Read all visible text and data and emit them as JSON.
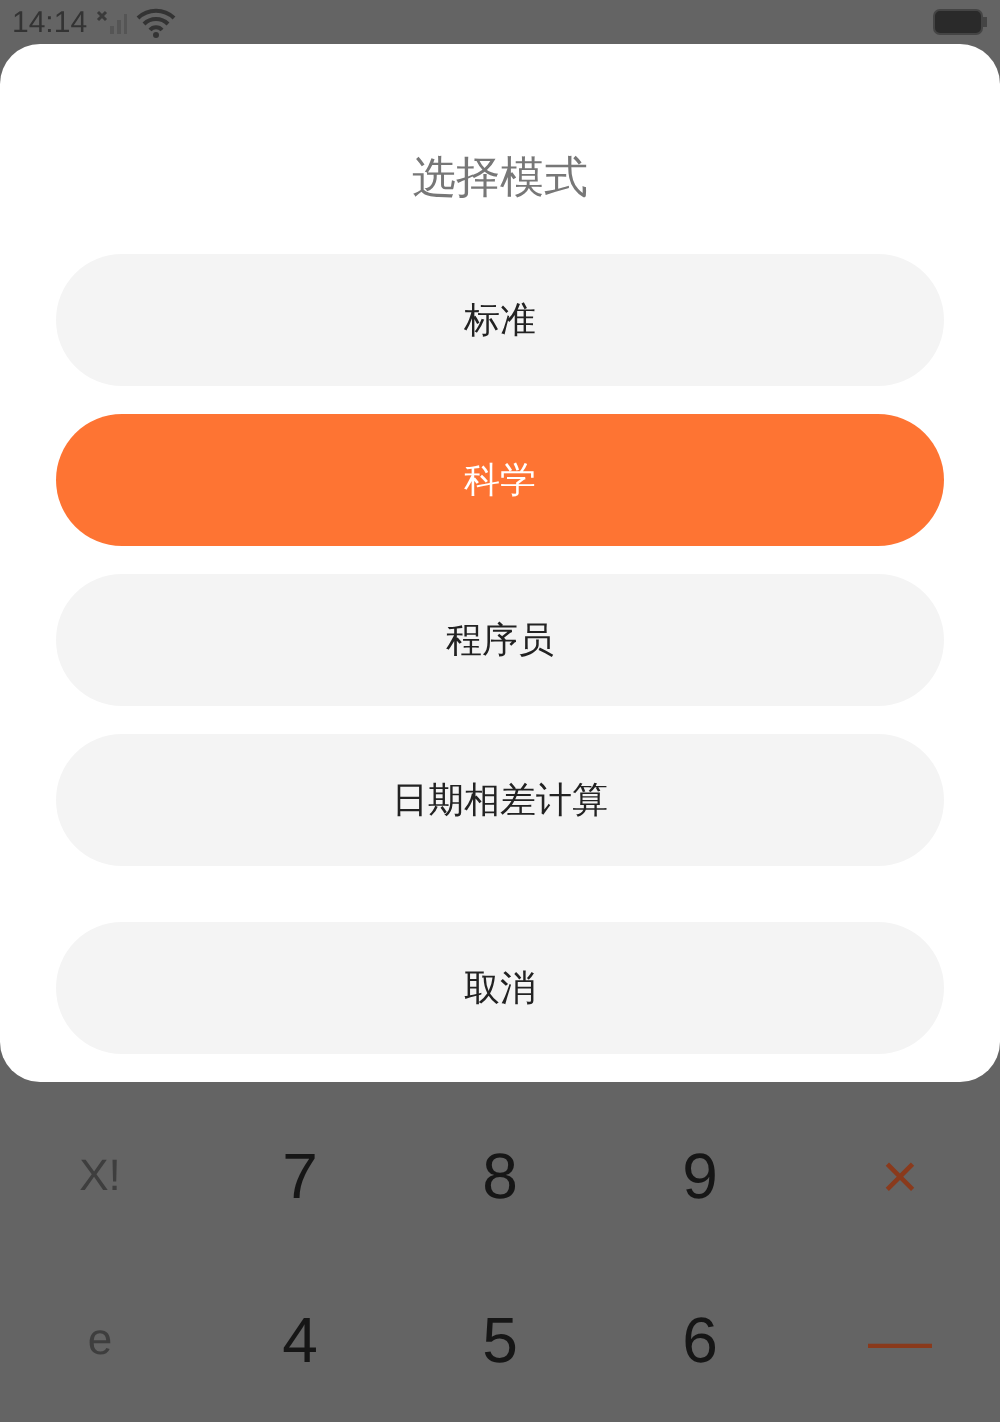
{
  "status_bar": {
    "time": "14:14"
  },
  "dialog": {
    "title": "选择模式",
    "options": [
      {
        "label": "标准",
        "selected": false
      },
      {
        "label": "科学",
        "selected": true
      },
      {
        "label": "程序员",
        "selected": false
      },
      {
        "label": "日期相差计算",
        "selected": false
      }
    ],
    "cancel": "取消"
  },
  "keypad": [
    [
      {
        "label": "X!",
        "kind": "function"
      },
      {
        "label": "7",
        "kind": "digit"
      },
      {
        "label": "8",
        "kind": "digit"
      },
      {
        "label": "9",
        "kind": "digit"
      },
      {
        "label": "×",
        "kind": "operator"
      }
    ],
    [
      {
        "label": "e",
        "kind": "function"
      },
      {
        "label": "4",
        "kind": "digit"
      },
      {
        "label": "5",
        "kind": "digit"
      },
      {
        "label": "6",
        "kind": "digit"
      },
      {
        "label": "—",
        "kind": "operator"
      }
    ]
  ]
}
